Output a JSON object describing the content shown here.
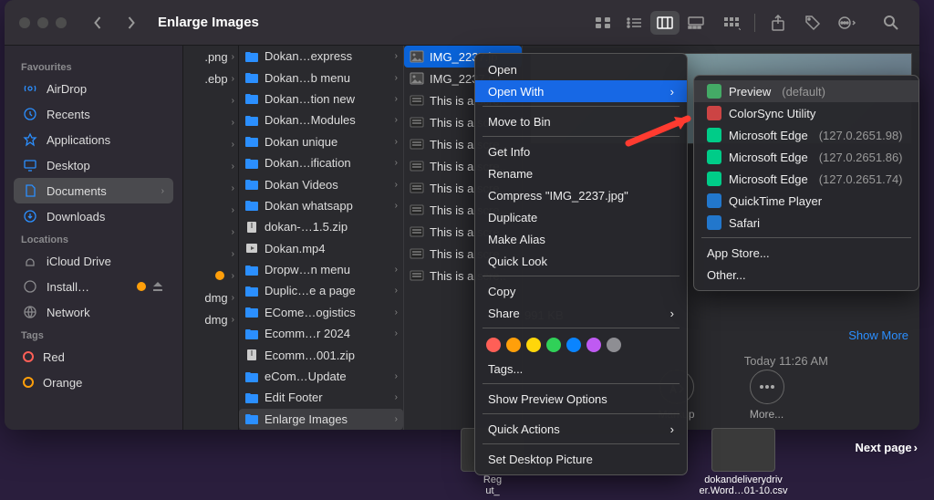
{
  "header": {
    "title": "Enlarge Images"
  },
  "sidebar": {
    "sections": {
      "favourites": "Favourites",
      "locations": "Locations",
      "tags": "Tags"
    },
    "favourites": [
      {
        "label": "AirDrop"
      },
      {
        "label": "Recents"
      },
      {
        "label": "Applications"
      },
      {
        "label": "Desktop"
      },
      {
        "label": "Documents"
      },
      {
        "label": "Downloads"
      }
    ],
    "locations": [
      {
        "label": "iCloud Drive"
      },
      {
        "label": "Install…"
      },
      {
        "label": "Network"
      }
    ],
    "tags": [
      {
        "label": "Red",
        "color": "#ff5f57"
      },
      {
        "label": "Orange",
        "color": "#ff9f0a"
      }
    ]
  },
  "col1": [
    ".png",
    ".ebp",
    "",
    "",
    "",
    "",
    "",
    "",
    "",
    "",
    "",
    "dmg",
    "dmg"
  ],
  "col2": [
    {
      "label": "Dokan…express",
      "chev": true,
      "type": "folder"
    },
    {
      "label": "Dokan…b menu",
      "chev": true,
      "type": "folder"
    },
    {
      "label": "Dokan…tion new",
      "chev": true,
      "type": "folder"
    },
    {
      "label": "Dokan…Modules",
      "chev": true,
      "type": "folder"
    },
    {
      "label": "Dokan unique",
      "chev": true,
      "type": "folder"
    },
    {
      "label": "Dokan…ification",
      "chev": true,
      "type": "folder"
    },
    {
      "label": "Dokan Videos",
      "chev": true,
      "type": "folder"
    },
    {
      "label": "Dokan whatsapp",
      "chev": true,
      "type": "folder"
    },
    {
      "label": "dokan-…1.5.zip",
      "chev": false,
      "type": "zip"
    },
    {
      "label": "Dokan.mp4",
      "chev": false,
      "type": "video"
    },
    {
      "label": "Dropw…n menu",
      "chev": true,
      "type": "folder"
    },
    {
      "label": "Duplic…e a page",
      "chev": true,
      "type": "folder"
    },
    {
      "label": "ECome…ogistics",
      "chev": true,
      "type": "folder"
    },
    {
      "label": "Ecomm…r 2024",
      "chev": true,
      "type": "folder"
    },
    {
      "label": "Ecomm…001.zip",
      "chev": false,
      "type": "zip"
    },
    {
      "label": "eCom…Update",
      "chev": true,
      "type": "folder"
    },
    {
      "label": "Edit Footer",
      "chev": true,
      "type": "folder"
    },
    {
      "label": "Enlarge Images",
      "chev": true,
      "type": "folder",
      "selected": true
    }
  ],
  "col3": [
    {
      "label": "IMG_2237.jp",
      "selected": true,
      "type": "jpg"
    },
    {
      "label": "IMG_2237.pn",
      "type": "png"
    },
    {
      "label": "This is a scre..",
      "type": "shot"
    },
    {
      "label": "This is a scre..",
      "type": "shot"
    },
    {
      "label": "This is a scre..",
      "type": "shot"
    },
    {
      "label": "This is a scre..",
      "type": "shot"
    },
    {
      "label": "This is a scre..",
      "type": "shot"
    },
    {
      "label": "This is a scre..",
      "type": "shot"
    },
    {
      "label": "This is a scre..",
      "type": "shot"
    },
    {
      "label": "This is a scre..",
      "type": "shot"
    },
    {
      "label": "This is a scre..",
      "type": "shot"
    }
  ],
  "preview": {
    "size": "991 KB",
    "show_more": "Show More",
    "modified": "Today  11:26 AM",
    "markup": "Markup",
    "more": "More..."
  },
  "ctx": {
    "open": "Open",
    "open_with": "Open With",
    "move_bin": "Move to Bin",
    "get_info": "Get Info",
    "rename": "Rename",
    "compress": "Compress \"IMG_2237.jpg\"",
    "duplicate": "Duplicate",
    "alias": "Make Alias",
    "quick_look": "Quick Look",
    "copy": "Copy",
    "share": "Share",
    "tags": "Tags...",
    "preview_opts": "Show Preview Options",
    "quick_actions": "Quick Actions",
    "desktop_pic": "Set Desktop Picture"
  },
  "sub": [
    {
      "name": "Preview",
      "suffix": "(default)",
      "icon": "#4a6",
      "sel": true
    },
    {
      "name": "ColorSync Utility",
      "icon": "#c44"
    },
    {
      "name": "Microsoft Edge",
      "suffix": "(127.0.2651.98)",
      "icon": "#0c8"
    },
    {
      "name": "Microsoft Edge",
      "suffix": "(127.0.2651.86)",
      "icon": "#0c8"
    },
    {
      "name": "Microsoft Edge",
      "suffix": "(127.0.2651.74)",
      "icon": "#0c8"
    },
    {
      "name": "QuickTime Player",
      "icon": "#27c"
    },
    {
      "name": "Safari",
      "icon": "#27c"
    }
  ],
  "sub_footer": {
    "app_store": "App Store...",
    "other": "Other..."
  },
  "tag_colors": [
    "#ff5f57",
    "#ff9f0a",
    "#ffd60a",
    "#30d158",
    "#0a84ff",
    "#bf5af2",
    "#8e8e93"
  ],
  "desktop": [
    {
      "line1": "Reg",
      "line2": "ut_"
    },
    {
      "line1": "dokandeliverydriv",
      "line2": "er.Word…01-10.csv"
    }
  ],
  "next_page": "Next page"
}
